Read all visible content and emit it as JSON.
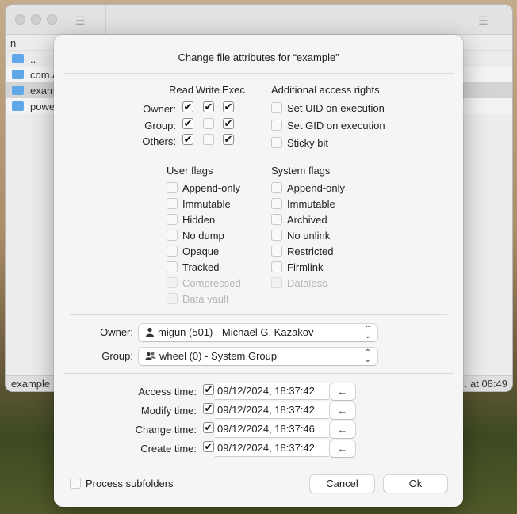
{
  "background": {
    "column_header": "n",
    "rows": [
      "..",
      "com.a",
      "exam",
      "powe"
    ],
    "status_left": "example",
    "status_right": ". at 08:49"
  },
  "dialog": {
    "title": "Change file attributes for “example”",
    "perm_headers": {
      "read": "Read",
      "write": "Write",
      "exec": "Exec"
    },
    "perm_rows": [
      {
        "label": "Owner:",
        "read": true,
        "write": true,
        "exec": true
      },
      {
        "label": "Group:",
        "read": true,
        "write": false,
        "exec": true
      },
      {
        "label": "Others:",
        "read": true,
        "write": false,
        "exec": true
      }
    ],
    "additional": {
      "title": "Additional access rights",
      "items": [
        {
          "label": "Set UID on execution",
          "checked": false
        },
        {
          "label": "Set GID on execution",
          "checked": false
        },
        {
          "label": "Sticky bit",
          "checked": false
        }
      ]
    },
    "user_flags": {
      "title": "User flags",
      "items": [
        {
          "label": "Append-only",
          "checked": false,
          "disabled": false
        },
        {
          "label": "Immutable",
          "checked": false,
          "disabled": false
        },
        {
          "label": "Hidden",
          "checked": false,
          "disabled": false
        },
        {
          "label": "No dump",
          "checked": false,
          "disabled": false
        },
        {
          "label": "Opaque",
          "checked": false,
          "disabled": false
        },
        {
          "label": "Tracked",
          "checked": false,
          "disabled": false
        },
        {
          "label": "Compressed",
          "checked": false,
          "disabled": true
        },
        {
          "label": "Data vault",
          "checked": false,
          "disabled": true
        }
      ]
    },
    "system_flags": {
      "title": "System flags",
      "items": [
        {
          "label": "Append-only",
          "checked": false,
          "disabled": false
        },
        {
          "label": "Immutable",
          "checked": false,
          "disabled": false
        },
        {
          "label": "Archived",
          "checked": false,
          "disabled": false
        },
        {
          "label": "No unlink",
          "checked": false,
          "disabled": false
        },
        {
          "label": "Restricted",
          "checked": false,
          "disabled": false
        },
        {
          "label": "Firmlink",
          "checked": false,
          "disabled": false
        },
        {
          "label": "Dataless",
          "checked": false,
          "disabled": true
        }
      ]
    },
    "owner": {
      "label": "Owner:",
      "value": "migun (501) - Michael G. Kazakov"
    },
    "group": {
      "label": "Group:",
      "value": "wheel (0) - System Group"
    },
    "times": [
      {
        "label": "Access time:",
        "checked": true,
        "value": "09/12/2024, 18:37:42"
      },
      {
        "label": "Modify time:",
        "checked": true,
        "value": "09/12/2024, 18:37:42"
      },
      {
        "label": "Change time:",
        "checked": true,
        "value": "09/12/2024, 18:37:46"
      },
      {
        "label": "Create time:",
        "checked": true,
        "value": "09/12/2024, 18:37:42"
      }
    ],
    "process_subfolders": {
      "label": "Process subfolders",
      "checked": false
    },
    "cancel_label": "Cancel",
    "ok_label": "Ok",
    "check_glyph": "✔",
    "reset_glyph": "←"
  }
}
